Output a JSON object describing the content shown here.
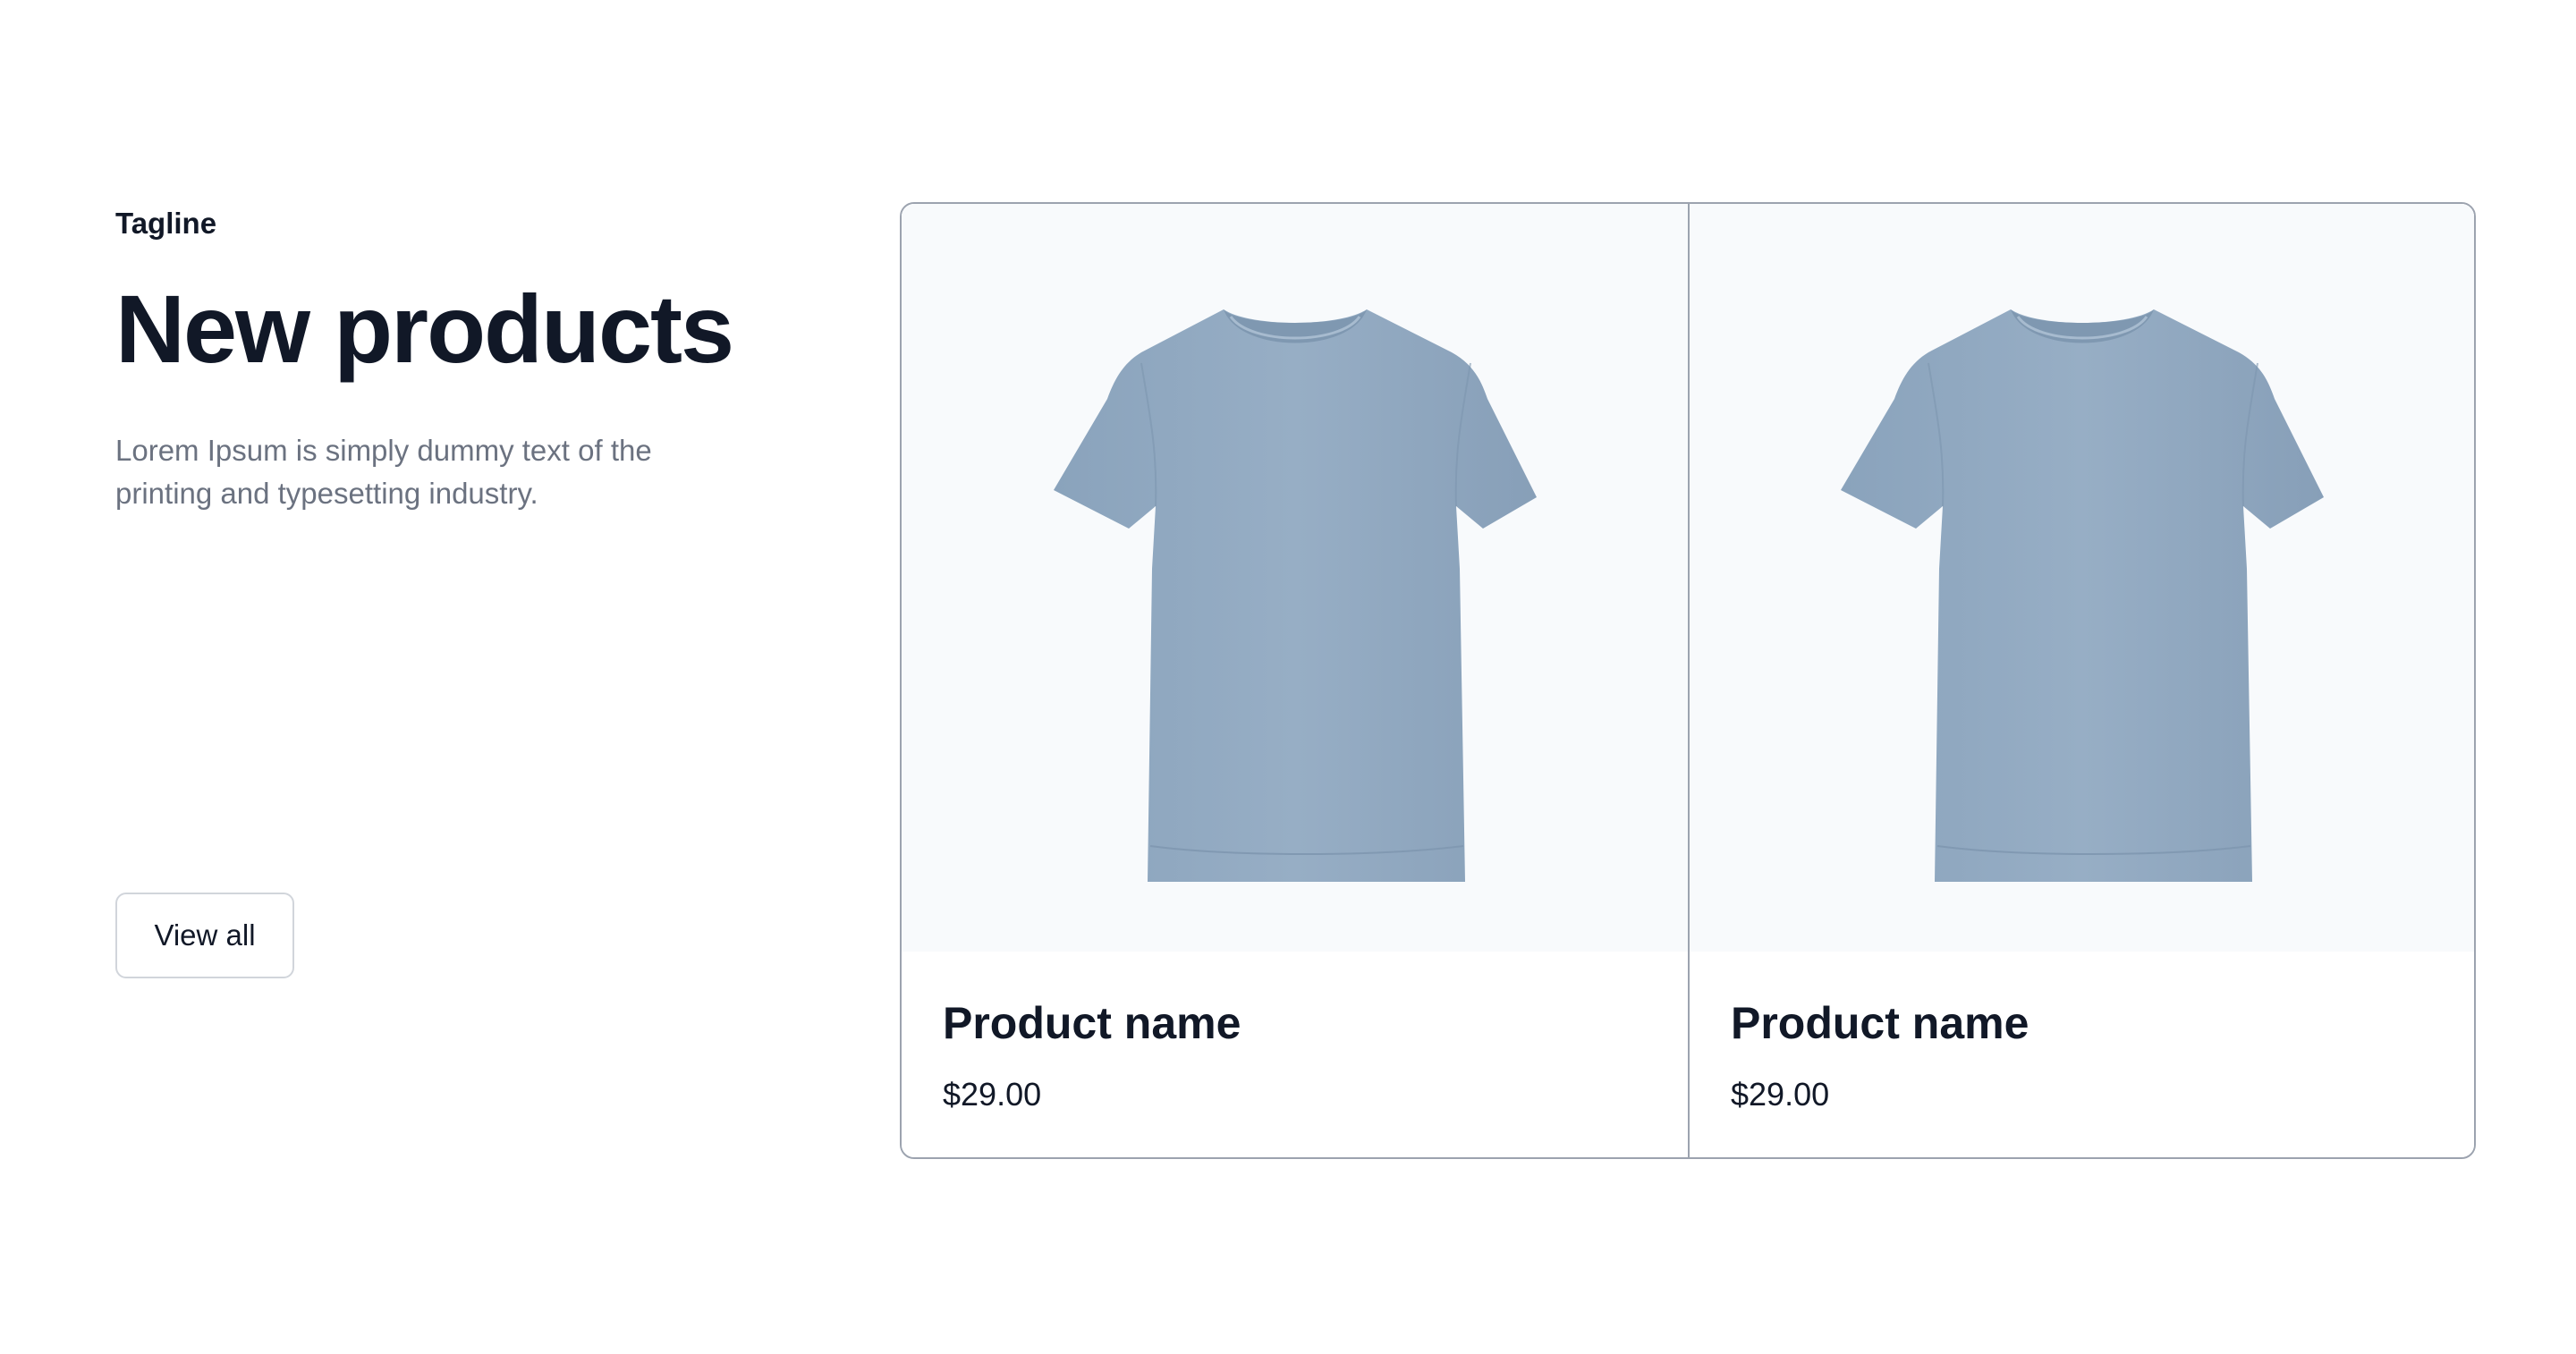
{
  "intro": {
    "tagline": "Tagline",
    "title": "New products",
    "description": "Lorem Ipsum is simply dummy text of the printing and typesetting industry.",
    "view_all_label": "View all"
  },
  "products": [
    {
      "name": "Product name",
      "price": "$29.00",
      "image": "t-shirt-image"
    },
    {
      "name": "Product name",
      "price": "$29.00",
      "image": "t-shirt-image"
    }
  ],
  "colors": {
    "heading": "#111827",
    "muted_text": "#6b7280",
    "card_border": "#9ca3af",
    "image_background": "#f8fafc",
    "shirt": "#93aac2"
  }
}
